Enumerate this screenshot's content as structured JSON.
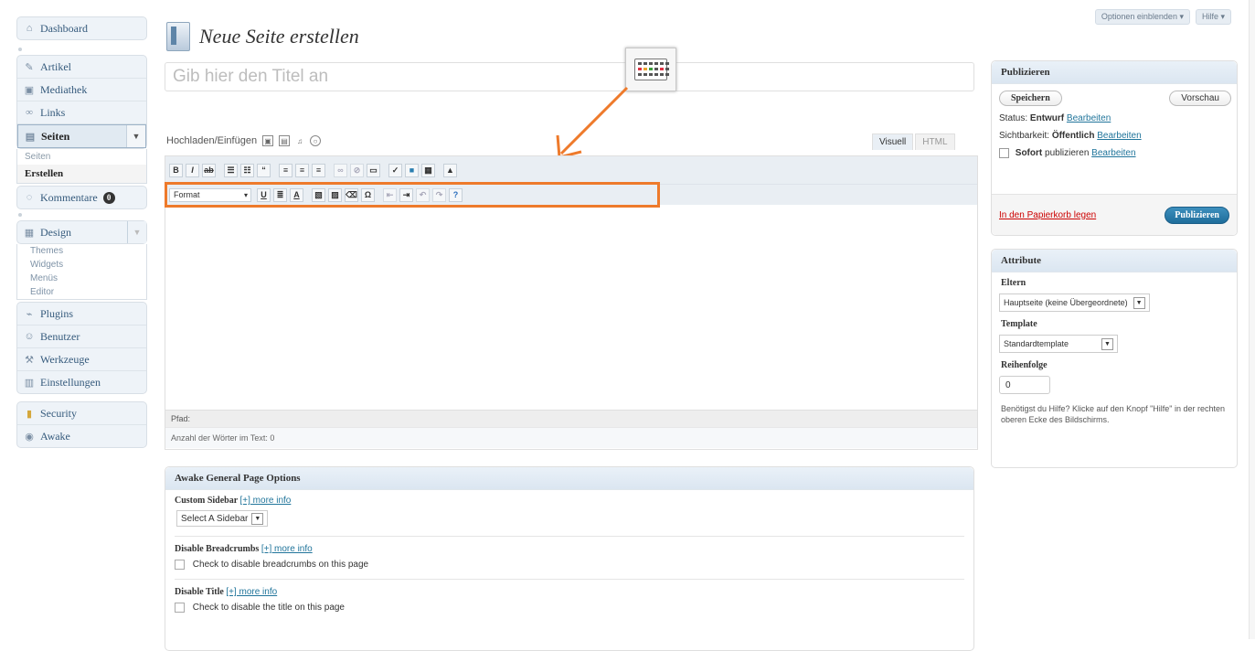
{
  "sidebar": {
    "dashboard": "Dashboard",
    "items": [
      {
        "label": "Artikel",
        "icon": "pin-icon"
      },
      {
        "label": "Mediathek",
        "icon": "media-icon"
      },
      {
        "label": "Links",
        "icon": "link-icon"
      }
    ],
    "pages": {
      "label": "Seiten",
      "sub": [
        "Seiten",
        "Erstellen"
      ]
    },
    "comments": {
      "label": "Kommentare",
      "count": "0"
    },
    "design": {
      "label": "Design",
      "sub": [
        "Themes",
        "Widgets",
        "Menüs",
        "Editor"
      ]
    },
    "items2": [
      {
        "label": "Plugins",
        "icon": "plugin-icon"
      },
      {
        "label": "Benutzer",
        "icon": "users-icon"
      },
      {
        "label": "Werkzeuge",
        "icon": "tools-icon"
      },
      {
        "label": "Einstellungen",
        "icon": "settings-icon"
      }
    ],
    "security": "Security",
    "awake": "Awake"
  },
  "topbar": {
    "screen_options": "Optionen einblenden ▾",
    "help": "Hilfe ▾"
  },
  "page": {
    "title": "Neue Seite erstellen",
    "title_placeholder": "Gib hier den Titel an"
  },
  "editor": {
    "upload_label": "Hochladen/Einfügen",
    "tab_visual": "Visuell",
    "tab_html": "HTML",
    "format": "Format",
    "path": "Pfad:",
    "word_count": "Anzahl der Wörter im Text: 0"
  },
  "awake_box": {
    "title": "Awake General Page Options",
    "custom_sidebar": "Custom Sidebar",
    "more_info": "[+] more info",
    "select_sidebar": "Select A Sidebar",
    "disable_breadcrumbs": "Disable Breadcrumbs",
    "breadcrumbs_check": "Check to disable breadcrumbs on this page",
    "disable_title": "Disable Title",
    "title_check": "Check to disable the title on this page"
  },
  "publish": {
    "title": "Publizieren",
    "save": "Speichern",
    "preview": "Vorschau",
    "status_label": "Status:",
    "status_value": "Entwurf",
    "visibility_label": "Sichtbarkeit:",
    "visibility_value": "Öffentlich",
    "schedule_value": "Sofort",
    "schedule_text": "publizieren",
    "edit": "Bearbeiten",
    "trash": "In den Papierkorb legen",
    "publish": "Publizieren"
  },
  "attributes": {
    "title": "Attribute",
    "parent_label": "Eltern",
    "parent_value": "Hauptseite (keine Übergeordnete)",
    "template_label": "Template",
    "template_value": "Standardtemplate",
    "order_label": "Reihenfolge",
    "order_value": "0",
    "help": "Benötigst du Hilfe? Klicke auf den Knopf \"Hilfe\" in der rechten oberen Ecke des Bildschirms."
  },
  "colors": {
    "accent": "#21759b",
    "highlight": "#ee7a2b",
    "publish_button": "#2a7fb0"
  }
}
